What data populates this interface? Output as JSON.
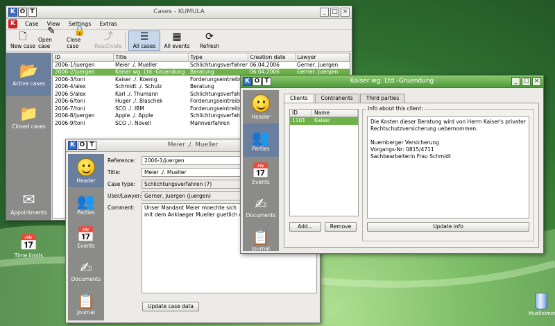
{
  "desktop": {
    "icon_label": "Muelleimer"
  },
  "cases_window": {
    "title": "Cases - KUMULA",
    "logo": [
      "K",
      "O",
      "T"
    ],
    "menu": [
      "Case",
      "View",
      "Settings",
      "Extras"
    ],
    "toolbar": [
      {
        "label": "New case",
        "icon": "new-case-icon",
        "glyph": "🗋"
      },
      {
        "label": "Open case",
        "icon": "open-case-icon",
        "glyph": "✎"
      },
      {
        "label": "Close case",
        "icon": "close-case-icon",
        "glyph": "🔒"
      },
      {
        "label": "Reactivate",
        "icon": "reactivate-icon",
        "glyph": "⤴",
        "disabled": true
      },
      {
        "label": "All cases",
        "icon": "all-cases-icon",
        "glyph": "☰",
        "pressed": true
      },
      {
        "label": "All events",
        "icon": "all-events-icon",
        "glyph": "▦"
      },
      {
        "label": "Refresh",
        "icon": "refresh-icon",
        "glyph": "⟳"
      }
    ],
    "sidebar": [
      {
        "label": "Active cases",
        "icon": "open-folder-icon",
        "glyph": "📂",
        "selected": true
      },
      {
        "label": "Closed cases",
        "icon": "closed-folder-icon",
        "glyph": "📁"
      },
      {
        "label": "",
        "icon": "",
        "glyph": ""
      },
      {
        "label": "Appointments",
        "icon": "appointments-icon",
        "glyph": "✉"
      },
      {
        "label": "Time limits",
        "icon": "calendar-icon",
        "glyph": "📅"
      }
    ],
    "columns": [
      "ID",
      "Title",
      "Type",
      "Creation date",
      "Lawyer"
    ],
    "rows": [
      [
        "2006-1/juergen",
        "Meier ./. Mueller",
        "Schlichtungsverfahren",
        "06.04.2006",
        "Gerner, Juergen"
      ],
      [
        "2006-2/juergen",
        "Kaiser wg. Ltd.-Gruendung",
        "Beratung",
        "06.04.2006",
        "Gerner, Juergen"
      ],
      [
        "2006-3/toni",
        "Kaiser ./. Koenig",
        "Forderungseintreibung",
        "",
        ""
      ],
      [
        "2006-4/alex",
        "Schmidt ./. Schulz",
        "Beratung",
        "",
        ""
      ],
      [
        "2006-5/alex",
        "Karl ./. Thumann",
        "Schlichtungsverfahren",
        "",
        ""
      ],
      [
        "2006-6/toni",
        "Huger ./. Blaschek",
        "Forderungseintreibung",
        "",
        ""
      ],
      [
        "2006-7/toni",
        "SCO ./. IBM",
        "Forderungseintreibung",
        "",
        ""
      ],
      [
        "2006-8/juergen",
        "Apple ./. Apple",
        "Schlichtungsverfahren",
        "",
        ""
      ],
      [
        "2006-9/toni",
        "SCO ./. Novell",
        "Mahnverfahren",
        "",
        ""
      ]
    ],
    "selected_row": 1
  },
  "meier_window": {
    "title": "Meier ./. Mueller",
    "logo": [
      "K",
      "O",
      "T"
    ],
    "sidebar": [
      {
        "label": "Header",
        "icon": "smiley-icon",
        "selected": true
      },
      {
        "label": "Parties",
        "icon": "parties-icon",
        "glyph": "👥"
      },
      {
        "label": "Events",
        "icon": "calendar-icon",
        "glyph": "📅"
      },
      {
        "label": "Documents",
        "icon": "documents-icon",
        "glyph": "✍"
      },
      {
        "label": "Journal",
        "icon": "journal-icon",
        "glyph": "📋"
      }
    ],
    "fields": {
      "reference_label": "Reference:",
      "reference": "2006-1/juergen",
      "title_label": "Title:",
      "title": "Meier ./. Mueller",
      "type_label": "Case type:",
      "type": "Schlichtungsverfahren (7)",
      "lawyer_label": "User/Lawyer:",
      "lawyer": "Gerner, Juergen (juergen)",
      "comment_label": "Comment:",
      "comment": "Unser Mandant Meier moechte sich\nmit dem Anklaeger Mueller guetlich einigen."
    },
    "update_button": "Update case data"
  },
  "kaiser_window": {
    "title": "Kaiser wg. Ltd.-Gruendung",
    "logo": [
      "K",
      "O",
      "T"
    ],
    "sidebar": [
      {
        "label": "Header",
        "icon": "smiley-icon"
      },
      {
        "label": "Parties",
        "icon": "parties-icon",
        "glyph": "👥",
        "selected": true
      },
      {
        "label": "Events",
        "icon": "calendar-icon",
        "glyph": "📅"
      },
      {
        "label": "Documents",
        "icon": "documents-icon",
        "glyph": "✍"
      },
      {
        "label": "Journal",
        "icon": "journal-icon",
        "glyph": "📋"
      }
    ],
    "tabs": [
      "Clients",
      "Contrahents",
      "Third parties"
    ],
    "selected_tab": 0,
    "clients_columns": [
      "ID",
      "Name"
    ],
    "clients": [
      [
        "1101",
        "Kaiser"
      ]
    ],
    "add_button": "Add...",
    "remove_button": "Remove",
    "info_legend": "Info about this client:",
    "info_lines": [
      "Die Kosten dieser Beratung wird von Herrn Kaiser's privater Rechtschutzversicherung uebernommen:",
      "Nuernberger Versicherung",
      "Vorgangs-Nr: 0815/4711",
      "Sachbearbeiterin Frau Schmidt"
    ],
    "update_button": "Update info"
  }
}
